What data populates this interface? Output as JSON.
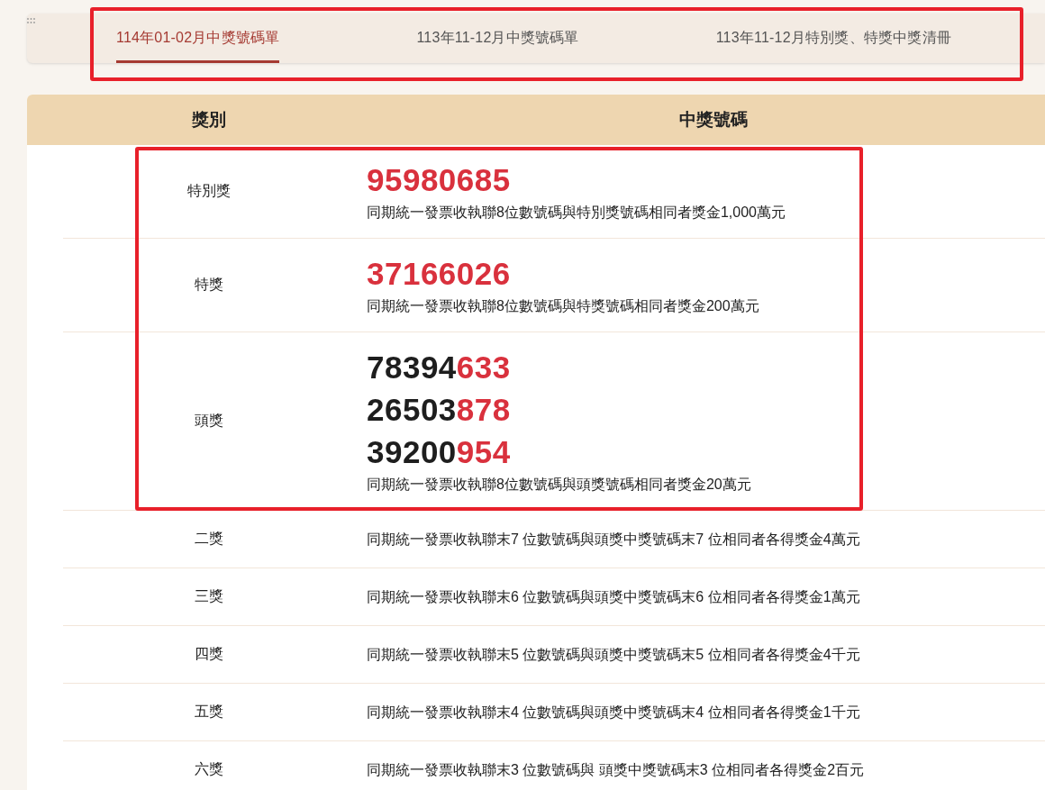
{
  "tabs": [
    {
      "label": "114年01-02月中獎號碼單",
      "selected": true
    },
    {
      "label": "113年11-12月中獎號碼單",
      "selected": false
    },
    {
      "label": "113年11-12月特別獎、特獎中獎清冊",
      "selected": false
    }
  ],
  "table": {
    "columns": [
      "獎別",
      "中獎號碼"
    ],
    "rows": [
      {
        "prize": "特別獎",
        "numbers": [
          {
            "tail": "95980685"
          }
        ],
        "note": "同期統一發票收執聯8位數號碼與特別獎號碼相同者獎金1,000萬元"
      },
      {
        "prize": "特獎",
        "numbers": [
          {
            "tail": "37166026"
          }
        ],
        "note": "同期統一發票收執聯8位數號碼與特獎號碼相同者獎金200萬元"
      },
      {
        "prize": "頭獎",
        "numbers": [
          {
            "lead": "78394",
            "tail": "633"
          },
          {
            "lead": "26503",
            "tail": "878"
          },
          {
            "lead": "39200",
            "tail": "954"
          }
        ],
        "note": "同期統一發票收執聯8位數號碼與頭獎號碼相同者獎金20萬元"
      },
      {
        "prize": "二獎",
        "note": "同期統一發票收執聯末7 位數號碼與頭獎中獎號碼末7 位相同者各得獎金4萬元"
      },
      {
        "prize": "三獎",
        "note": "同期統一發票收執聯末6 位數號碼與頭獎中獎號碼末6 位相同者各得獎金1萬元"
      },
      {
        "prize": "四獎",
        "note": "同期統一發票收執聯末5 位數號碼與頭獎中獎號碼末5 位相同者各得獎金4千元"
      },
      {
        "prize": "五獎",
        "note": "同期統一發票收執聯末4 位數號碼與頭獎中獎號碼末4 位相同者各得獎金1千元"
      },
      {
        "prize": "六獎",
        "note": "同期統一發票收執聯末3 位數號碼與 頭獎中獎號碼末3 位相同者各得獎金2百元"
      }
    ]
  }
}
